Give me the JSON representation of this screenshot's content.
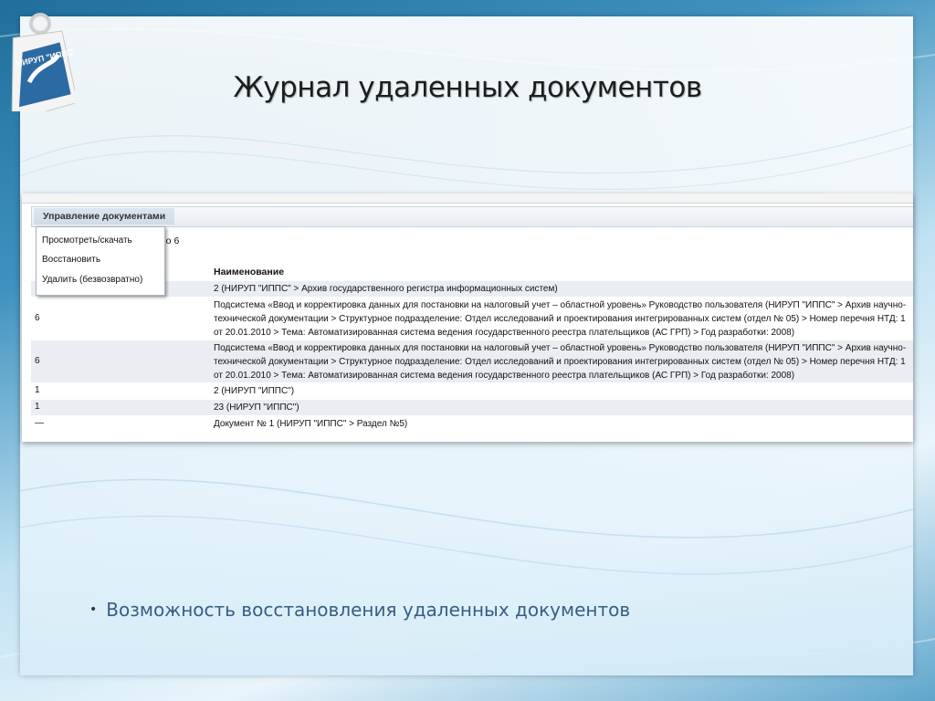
{
  "slide": {
    "title": "Журнал удаленных документов",
    "logo_text": "НИРУП \"ИППС\"",
    "bullet": "Возможность восстановления удаленных документов"
  },
  "app": {
    "menu_tab": "Управление документами",
    "behind_text": "по 6",
    "column_header": "Наименование",
    "dropdown": [
      {
        "label": "Просмотреть/скачать"
      },
      {
        "label": "Восстановить"
      },
      {
        "label": "Удалить (безвозвратно)"
      }
    ],
    "rows": [
      {
        "c1": "",
        "c2": "2 (НИРУП \"ИППС\" > Архив государственного регистра информационных систем)"
      },
      {
        "c1": "6",
        "c2": "Подсистема «Ввод и корректировка данных для постановки на налоговый учет – областной уровень» Руководство пользователя (НИРУП \"ИППС\" > Архив научно-технической документации > Структурное подразделение: Отдел исследований и проектирования интегрированных систем (отдел № 05) > Номер перечня НТД: 1 от 20.01.2010 > Тема: Автоматизированная система ведения государственного реестра плательщиков (АС ГРП) > Год разработки: 2008)"
      },
      {
        "c1": "6",
        "c2": "Подсистема «Ввод и корректировка данных для постановки на налоговый учет – областной уровень» Руководство пользователя (НИРУП \"ИППС\" > Архив научно-технической документации > Структурное подразделение: Отдел исследований и проектирования интегрированных систем (отдел № 05) > Номер перечня НТД: 1 от 20.01.2010 > Тема: Автоматизированная система ведения государственного реестра плательщиков (АС ГРП) > Год разработки: 2008)"
      },
      {
        "c1": "1",
        "c2": "2 (НИРУП \"ИППС\")"
      },
      {
        "c1": "1",
        "c2": "23 (НИРУП \"ИППС\")"
      },
      {
        "c1": "—",
        "c2": "Документ № 1 (НИРУП \"ИППС\" > Раздел №5)"
      }
    ]
  }
}
